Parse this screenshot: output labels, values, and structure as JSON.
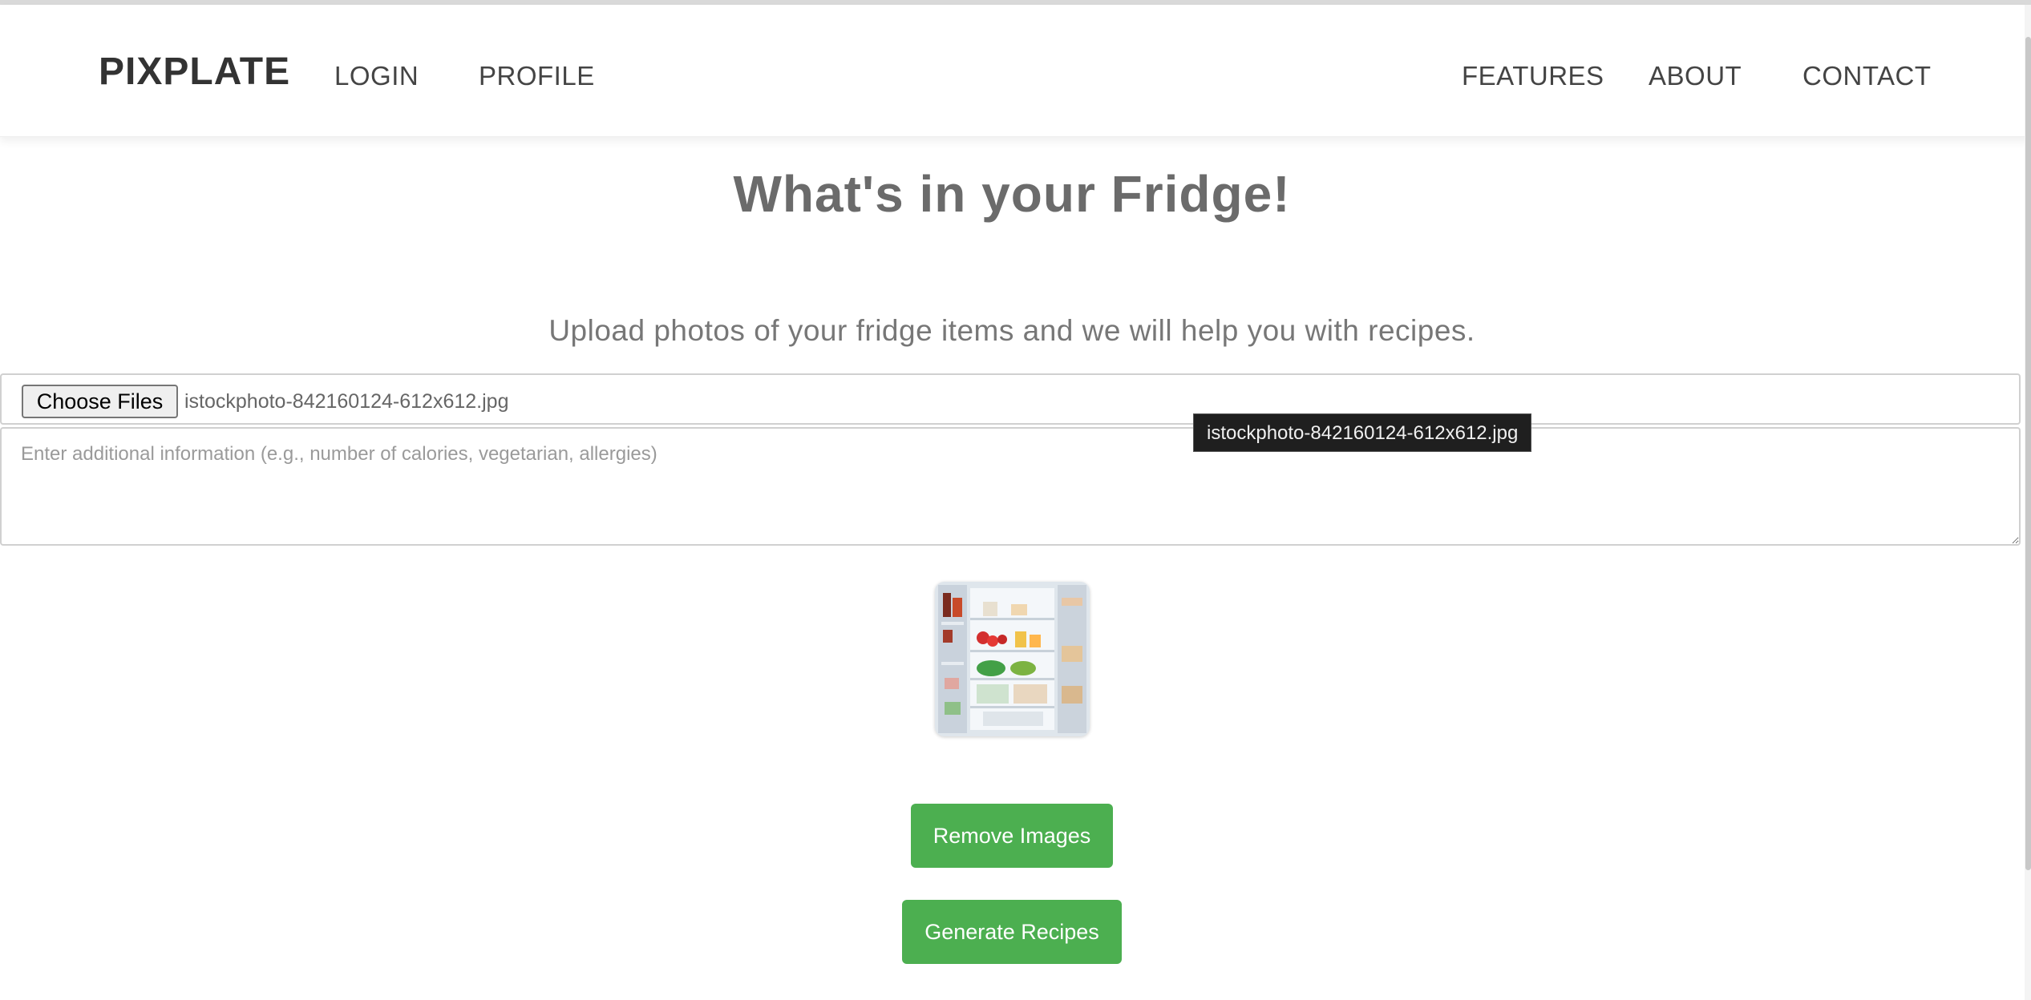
{
  "navbar": {
    "brand": "PIXPLATE",
    "left_links": [
      {
        "label": "LOGIN"
      },
      {
        "label": "PROFILE"
      }
    ],
    "right_links": [
      {
        "label": "FEATURES"
      },
      {
        "label": "ABOUT"
      },
      {
        "label": "CONTACT"
      }
    ]
  },
  "main": {
    "title": "What's in your Fridge!",
    "subtitle": "Upload photos of your fridge items and we will help you with recipes.",
    "file_input": {
      "button_label": "Choose Files",
      "selected_file": "istockphoto-842160124-612x612.jpg"
    },
    "tooltip": "istockphoto-842160124-612x612.jpg",
    "info_field": {
      "placeholder": "Enter additional information (e.g., number of calories, vegetarian, allergies)",
      "value": ""
    },
    "preview_icon": "fridge-photo-thumbnail",
    "remove_button": "Remove Images",
    "generate_button": "Generate Recipes"
  },
  "colors": {
    "accent": "#4caf50",
    "title": "#6b6b6b",
    "tooltip_bg": "#1f1f1f"
  }
}
